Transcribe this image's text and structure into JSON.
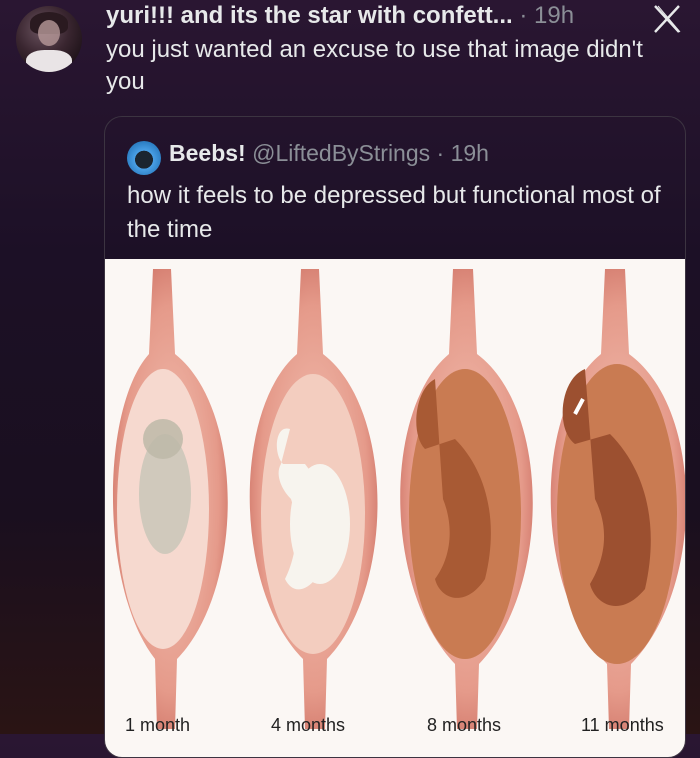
{
  "tweet": {
    "author_name": "yuri!!! and its the star with confett...",
    "time": " · 19h",
    "text": "you just wanted an excuse to use that image didn't you"
  },
  "quoted": {
    "author_name": "Beebs!",
    "handle": "@LiftedByStrings",
    "time": " · 19h",
    "text": "how it feels to be depressed but functional most of the time"
  },
  "image_captions": [
    "1 month",
    "4 months",
    "8 months",
    "11 months"
  ],
  "icons": {
    "close": "x-logo-icon",
    "quoted_avatar": "bird-avatar-icon"
  },
  "colors": {
    "background": "#1c1026",
    "text": "#e7e9ea",
    "muted": "#8b8f97",
    "figure_bg": "#fbf7f4"
  }
}
